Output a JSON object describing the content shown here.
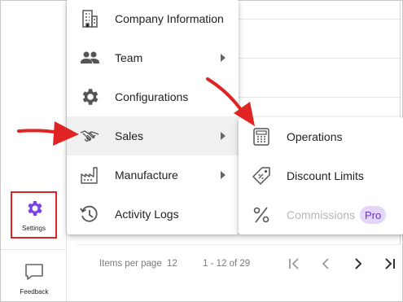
{
  "colors": {
    "accent": "#7b3fe4",
    "annotation_red": "#e02424",
    "pro_badge_bg": "#e3d6f8",
    "pro_badge_text": "#6a33c2",
    "active_bg": "#f0f0f0"
  },
  "sidebar": {
    "settings": {
      "label": "Settings",
      "icon": "gear-icon"
    },
    "feedback": {
      "label": "Feedback",
      "icon": "chat-bubble-icon"
    }
  },
  "pager": {
    "items_per_page_label": "Items per page",
    "items_per_page_value": "12",
    "range_text": "1 - 12 of 29"
  },
  "menu": {
    "items": [
      {
        "label": "Company Information",
        "icon": "building-icon"
      },
      {
        "label": "Team",
        "icon": "team-icon",
        "submenu": true
      },
      {
        "label": "Configurations",
        "icon": "gear-icon"
      },
      {
        "label": "Sales",
        "icon": "handshake-icon",
        "submenu": true,
        "active": true
      },
      {
        "label": "Manufacture",
        "icon": "factory-icon",
        "submenu": true
      },
      {
        "label": "Activity Logs",
        "icon": "history-icon"
      }
    ]
  },
  "submenu": {
    "items": [
      {
        "label": "Operations",
        "icon": "calculator-icon"
      },
      {
        "label": "Discount Limits",
        "icon": "price-tag-icon"
      },
      {
        "label": "Commissions",
        "icon": "percent-icon",
        "disabled": true,
        "badge": "Pro"
      }
    ]
  }
}
